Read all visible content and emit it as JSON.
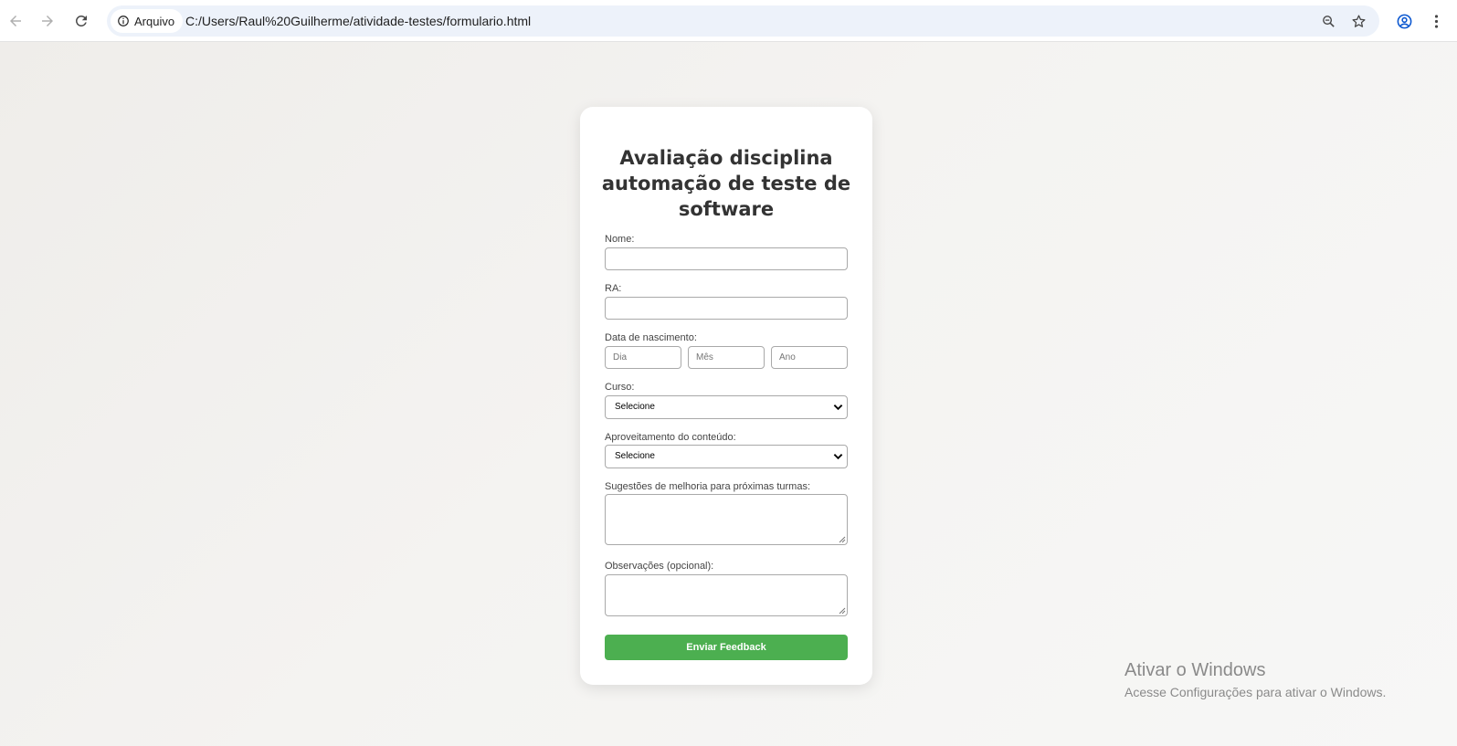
{
  "browser": {
    "security_chip_label": "Arquivo",
    "url": "C:/Users/Raul%20Guilherme/atividade-testes/formulario.html",
    "icons": [
      "back-icon",
      "forward-icon",
      "reload-icon",
      "info-icon",
      "zoom-icon",
      "star-icon",
      "profile-icon",
      "menu-icon"
    ]
  },
  "form": {
    "title": "Avaliação disciplina automação de teste de software",
    "nome_label": "Nome:",
    "ra_label": "RA:",
    "birth_label": "Data de nascimento:",
    "dia_placeholder": "Dia",
    "mes_placeholder": "Mês",
    "ano_placeholder": "Ano",
    "curso_label": "Curso:",
    "curso_selected": "Selecione",
    "aproveitamento_label": "Aproveitamento do conteúdo:",
    "aproveitamento_selected": "Selecione",
    "sugestoes_label": "Sugestões de melhoria para próximas turmas:",
    "observacoes_label": "Observações (opcional):",
    "submit_label": "Enviar Feedback"
  },
  "colors": {
    "accent_button": "#4caf50",
    "omnibox_bg": "#edf2fa",
    "profile_icon": "#0b57d0"
  },
  "watermark": {
    "title": "Ativar o Windows",
    "subtitle": "Acesse Configurações para ativar o Windows."
  }
}
